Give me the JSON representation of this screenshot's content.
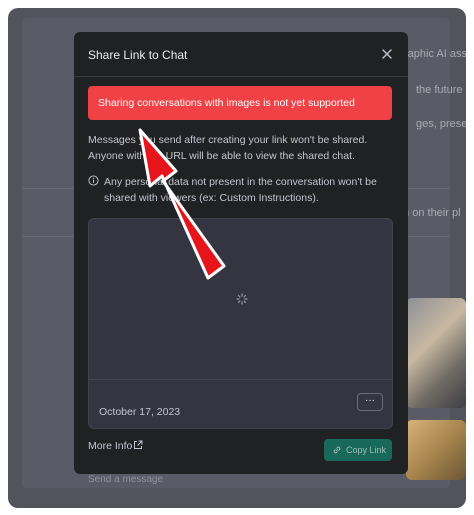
{
  "background": {
    "snippets": [
      "raphic AI asse",
      "the future re",
      "ges, present",
      "m on their pl"
    ],
    "input_placeholder": "Send a message"
  },
  "modal": {
    "title": "Share Link to Chat",
    "close_icon": "close-icon",
    "alert": "Sharing conversations with images is not yet supported",
    "description": "Messages you send after creating your link won't be shared. Anyone with the URL will be able to view the shared chat.",
    "privacy_note": "Any personal data not present in the conversation won't be shared with viewers (ex: Custom Instructions).",
    "preview": {
      "date": "October 17, 2023",
      "more_label": "···",
      "loading_icon": "spinner-icon"
    },
    "more_info": "More Info",
    "copy_link": "Copy Link"
  },
  "colors": {
    "alert": "#ef4146",
    "modal_bg": "#202123",
    "copy_button": "#19695a",
    "annotation_arrow": "#e8141b"
  }
}
